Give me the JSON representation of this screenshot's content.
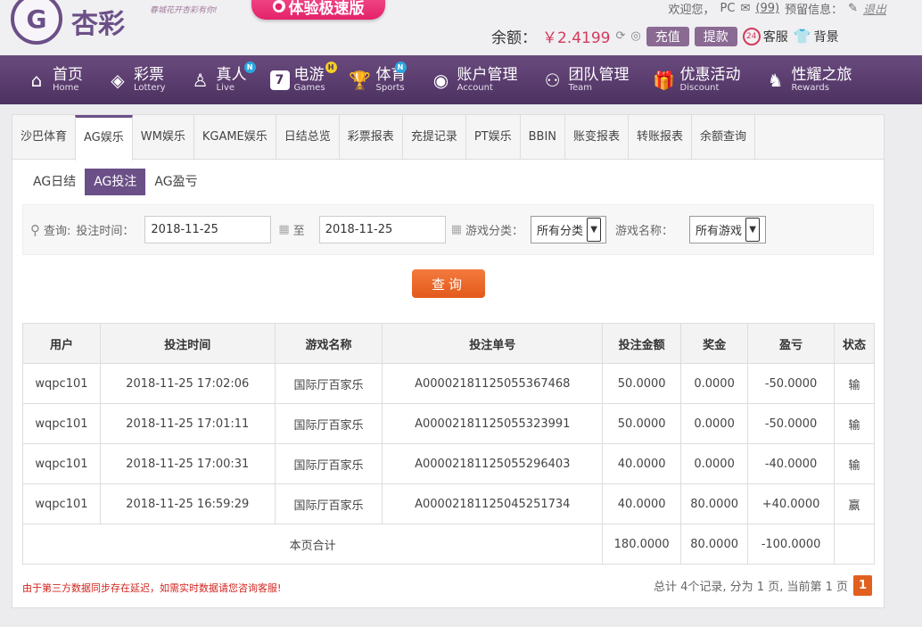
{
  "header": {
    "logo_text": "杏彩",
    "slogan": "春城花开杏彩有你!",
    "promo_label": "体验极速版",
    "welcome": "欢迎您，",
    "username": "PC",
    "message_count": "(99)",
    "notice_label": "预留信息：",
    "logout_label": "退出",
    "balance_label": "余额：",
    "balance_value": "￥2.4199",
    "recharge_label": "充值",
    "withdraw_label": "提款",
    "cs_badge": "24",
    "cs_label": "客服",
    "bg_label": "背景"
  },
  "nav": {
    "items": [
      {
        "cn": "首页",
        "en": "Home",
        "icon": "house-icon"
      },
      {
        "cn": "彩票",
        "en": "Lottery",
        "icon": "ticket-icon"
      },
      {
        "cn": "真人",
        "en": "Live",
        "icon": "person-icon",
        "badge": "N"
      },
      {
        "cn": "电游",
        "en": "Games",
        "icon": "number-seven-icon",
        "badge": "H"
      },
      {
        "cn": "体育",
        "en": "Sports",
        "icon": "trophy-icon",
        "badge": "N"
      },
      {
        "cn": "账户管理",
        "en": "Account",
        "icon": "account-icon"
      },
      {
        "cn": "团队管理",
        "en": "Team",
        "icon": "team-icon"
      },
      {
        "cn": "优惠活动",
        "en": "Discount",
        "icon": "gift-icon"
      },
      {
        "cn": "性耀之旅",
        "en": "Rewards",
        "icon": "rewards-icon"
      }
    ]
  },
  "tabs": [
    "沙巴体育",
    "AG娱乐",
    "WM娱乐",
    "KGAME娱乐",
    "日结总览",
    "彩票报表",
    "充提记录",
    "PT娱乐",
    "BBIN",
    "账变报表",
    "转账报表",
    "余额查询"
  ],
  "subtabs": [
    "AG日结",
    "AG投注",
    "AG盈亏"
  ],
  "filter": {
    "query_label": "查询:",
    "time_label": "投注时间：",
    "start_date": "2018-11-25",
    "to_label": "至",
    "end_date": "2018-11-25",
    "category_label": "游戏分类：",
    "category_value": "所有分类",
    "game_label": "游戏名称：",
    "game_value": "所有游戏",
    "search_label": "查询"
  },
  "table": {
    "headers": [
      "用户",
      "投注时间",
      "游戏名称",
      "投注单号",
      "投注金额",
      "奖金",
      "盈亏",
      "状态"
    ],
    "rows": [
      [
        "wqpc101",
        "2018-11-25 17:02:06",
        "国际厅百家乐",
        "A00002181125055367468",
        "50.0000",
        "0.0000",
        "-50.0000",
        "输"
      ],
      [
        "wqpc101",
        "2018-11-25 17:01:11",
        "国际厅百家乐",
        "A00002181125055323991",
        "50.0000",
        "0.0000",
        "-50.0000",
        "输"
      ],
      [
        "wqpc101",
        "2018-11-25 17:00:31",
        "国际厅百家乐",
        "A00002181125055296403",
        "40.0000",
        "0.0000",
        "-40.0000",
        "输"
      ],
      [
        "wqpc101",
        "2018-11-25 16:59:29",
        "国际厅百家乐",
        "A00002181125045251734",
        "40.0000",
        "80.0000",
        "+40.0000",
        "赢"
      ]
    ],
    "summary_label": "本页合计",
    "summary_bet": "180.0000",
    "summary_prize": "80.0000",
    "summary_profit": "-100.0000"
  },
  "footer": {
    "note": "由于第三方数据同步存在延迟，如需实时数据请您咨询客服!",
    "pager_text": "总计 4个记录, 分为 1 页, 当前第 1 页",
    "current_page": "1"
  },
  "colors": {
    "brand": "#6b4f87",
    "loss": "#d0251f",
    "win": "#1a8a2a",
    "accent": "#e25a1a"
  }
}
